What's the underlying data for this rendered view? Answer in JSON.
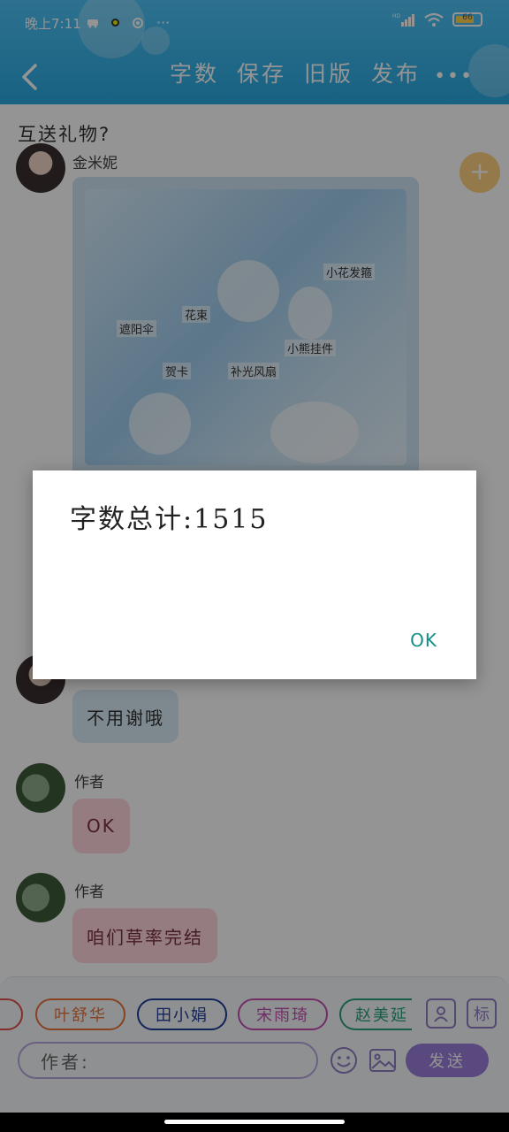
{
  "status_bar": {
    "time": "晚上7:11",
    "notif_more": "···",
    "battery": "66"
  },
  "header": {
    "back_icon": "chevron-left-icon",
    "actions": [
      "字数",
      "保存",
      "旧版",
      "发布"
    ],
    "more": "•••"
  },
  "chat": {
    "topic": "互送礼物?",
    "first_sender": "金米妮",
    "photo_labels": [
      "小花发箍",
      "花束",
      "遮阳伞",
      "小熊挂件",
      "贺卡",
      "补光风扇"
    ],
    "messages": [
      {
        "text": "不用谢哦",
        "style": "blue"
      },
      {
        "sender": "作者",
        "text": "OK",
        "style": "pink"
      },
      {
        "sender": "作者",
        "text": "咱们草率完结",
        "style": "pink"
      }
    ]
  },
  "composer": {
    "characters": [
      "叶舒华",
      "田小娟",
      "宋雨琦",
      "赵美延"
    ],
    "character_colors": [
      "#e8733a",
      "#1f3d99",
      "#c24fb0",
      "#2aa37a"
    ],
    "profile_icon": "person-icon",
    "tag_label": "标",
    "input_value": "作者:",
    "emoji_icon": "smiley-icon",
    "image_icon": "image-icon",
    "send_label": "发送"
  },
  "dialog": {
    "message": "字数总计:1515",
    "ok_label": "OK"
  }
}
